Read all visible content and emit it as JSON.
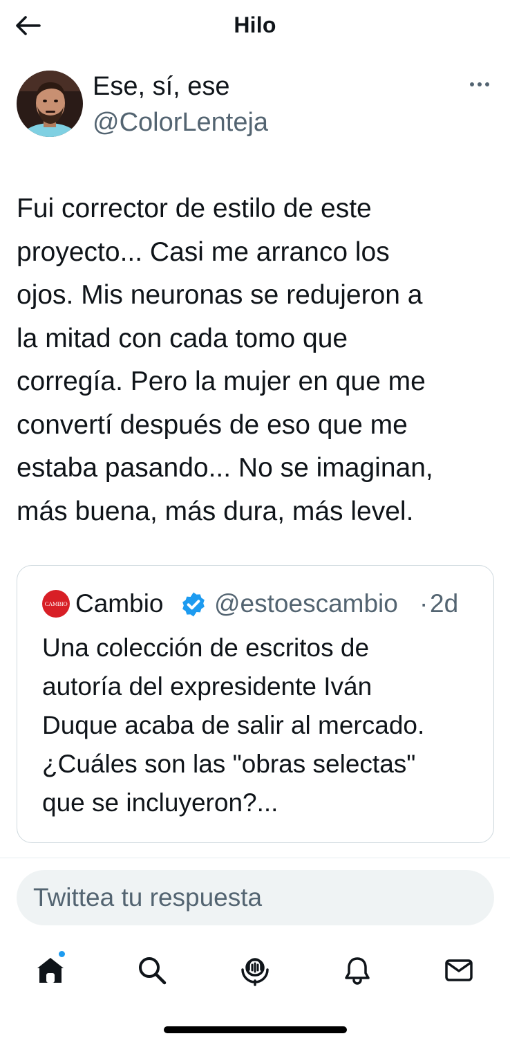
{
  "header": {
    "back_icon": "arrow-left-icon",
    "title": "Hilo"
  },
  "tweet": {
    "display_name": "Ese, sí, ese",
    "handle": "@ColorLenteja",
    "more_icon": "more-horizontal-icon",
    "text": "Fui corrector de estilo de este\nproyecto... Casi me arranco los\nojos. Mis neuronas se redujeron a\nla mitad con cada tomo que\ncorregía. Pero la mujer en que me\nconvertí después de eso que me\nestaba pasando... No se imaginan,\nmás buena, más dura, más level."
  },
  "quote": {
    "logo_text": "CAMBIO",
    "name": "Cambio",
    "verified_icon": "verified-badge-icon",
    "handle": "@estoescambio",
    "separator": "·",
    "time": "2d",
    "text": "Una colección de escritos de\nautoría del expresidente Iván\nDuque acaba de salir al mercado.\n¿Cuáles son las \"obras selectas\"\nque se incluyeron?..."
  },
  "reply": {
    "placeholder": "Twittea tu respuesta"
  },
  "tabs": [
    {
      "icon": "home-icon"
    },
    {
      "icon": "search-icon"
    },
    {
      "icon": "spaces-icon"
    },
    {
      "icon": "bell-icon"
    },
    {
      "icon": "mail-icon"
    }
  ],
  "colors": {
    "text": "#0f1419",
    "secondary": "#536471",
    "accent": "#1d9bf0",
    "border": "#cfd9de",
    "input_bg": "#eff3f4",
    "cambio_red": "#d81f26"
  }
}
